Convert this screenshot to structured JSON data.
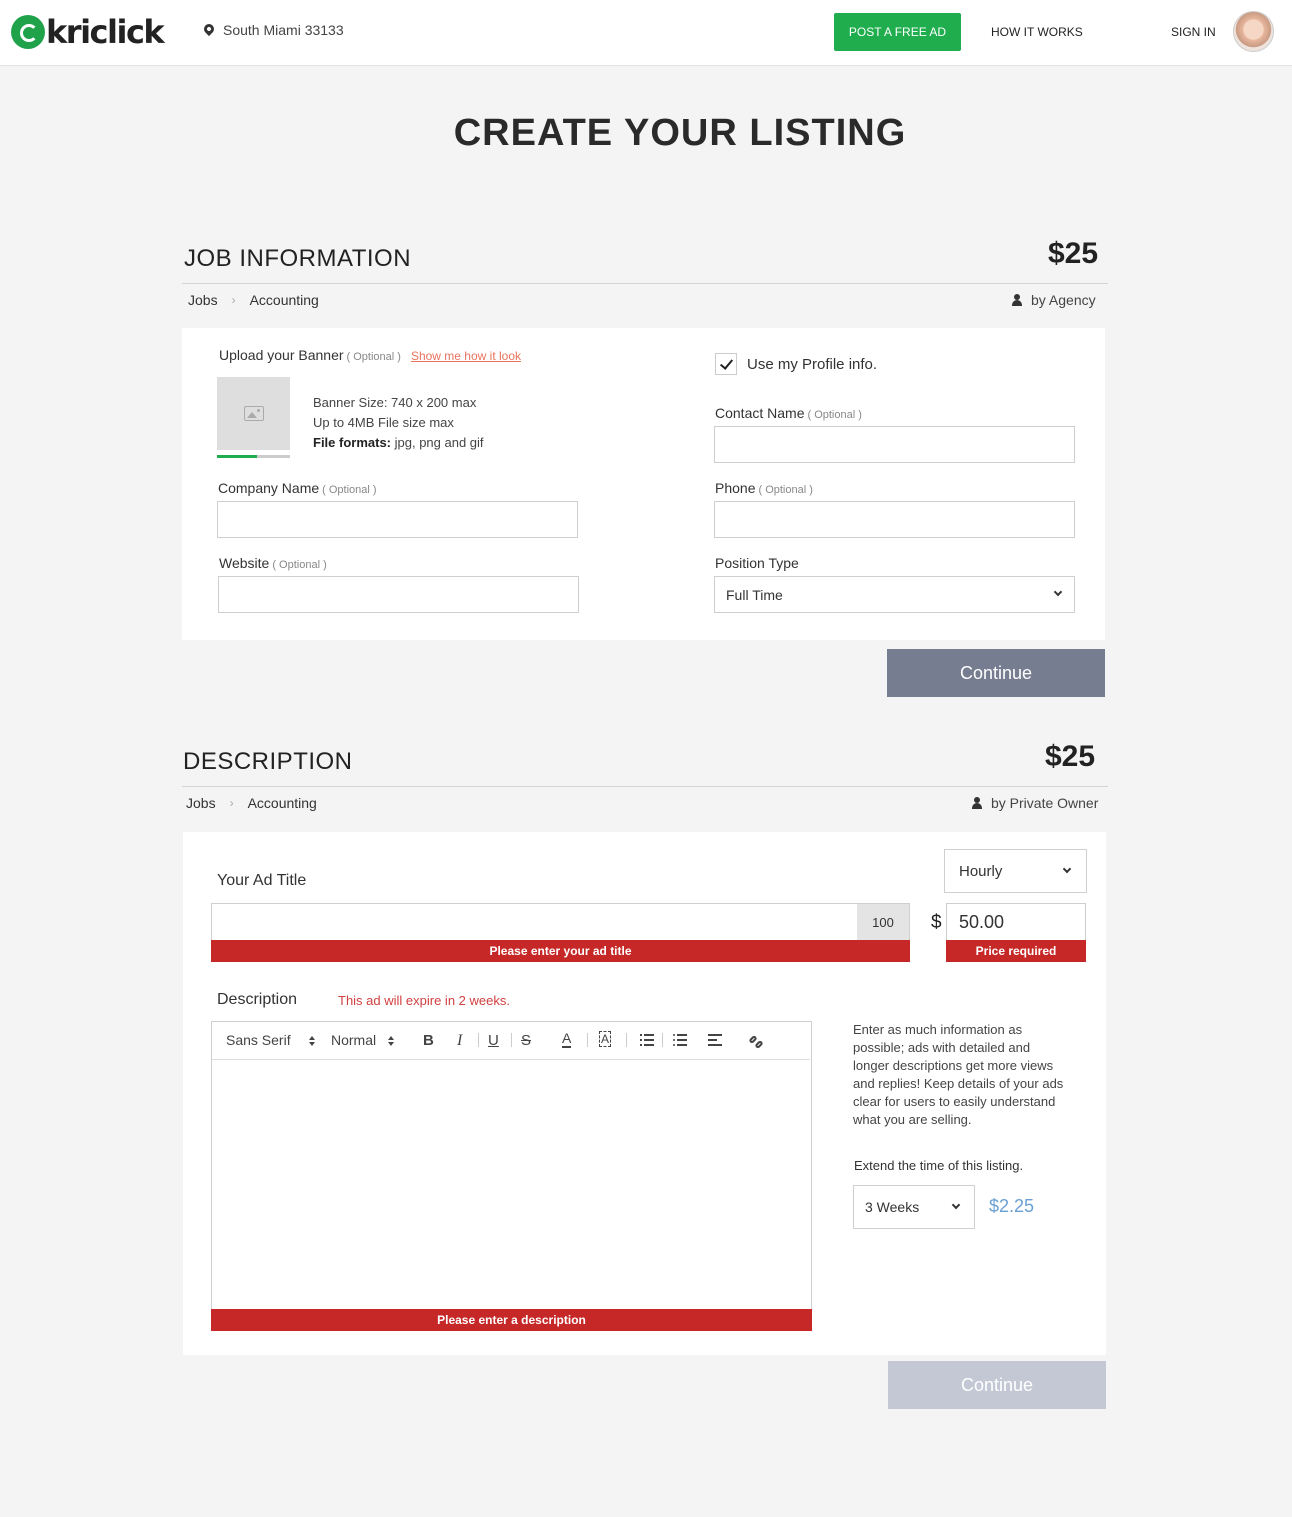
{
  "header": {
    "logo_text": "kriclick",
    "location": "South Miami 33133",
    "post_ad": "POST A FREE AD",
    "how_it_works": "HOW IT WORKS",
    "sign_in": "SIGN IN"
  },
  "page_title": "CREATE YOUR LISTING",
  "job_section": {
    "title": "JOB INFORMATION",
    "price": "$25",
    "crumb": [
      "Jobs",
      "Accounting"
    ],
    "by": "by Agency",
    "upload_label": "Upload your Banner",
    "optional": "( Optional )",
    "show_me": "Show me how it look",
    "upload_progress": 0.55,
    "banner_size": "Banner Size: 740 x 200 max",
    "file_size": "Up to 4MB File size max",
    "formats_label": "File formats:",
    "formats_value": " jpg, png and gif",
    "company_label": "Company Name",
    "website_label": "Website",
    "use_profile": "Use my Profile info.",
    "contact_label": "Contact Name",
    "phone_label": "Phone",
    "position_label": "Position Type",
    "position_value": "Full Time",
    "continue": "Continue"
  },
  "desc_section": {
    "title": "DESCRIPTION",
    "price": "$25",
    "crumb": [
      "Jobs",
      "Accounting"
    ],
    "by": "by Private Owner",
    "ad_title_label": "Your Ad Title",
    "char_count": "100",
    "ad_title_error": "Please enter your ad title",
    "rate_value": "Hourly",
    "currency": "$",
    "price_value": "50.00",
    "price_error": "Price required",
    "description_label": "Description",
    "expire_note": "This ad will expire in 2 weeks.",
    "font_value": "Sans Serif",
    "size_value": "Normal",
    "description_error": "Please enter a description",
    "help_text": "Enter as much information as possible; ads with detailed and longer descriptions get more views and replies!  Keep details of your ads clear for users to easily understand  what you are selling.",
    "extend_label": "Extend the time of this listing.",
    "extend_value": "3 Weeks",
    "extend_price": "$2.25",
    "continue": "Continue"
  },
  "colors": {
    "brand_green": "#1fad4d",
    "error_red": "#c62828",
    "continue_active": "#767d90",
    "continue_disabled": "#c4c8d4",
    "extend_price_blue": "#6a9fd4"
  }
}
